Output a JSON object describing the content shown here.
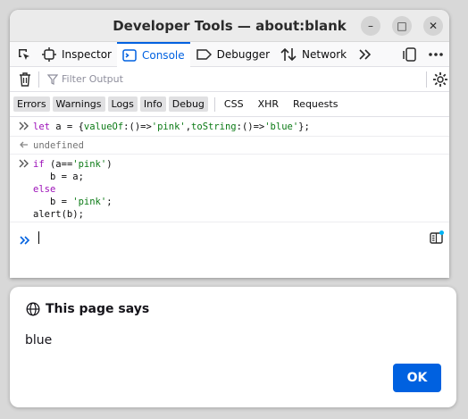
{
  "window": {
    "title": "Developer Tools — about:blank",
    "minimize_glyph": "–",
    "maximize_glyph": "□",
    "close_glyph": "✕"
  },
  "tabs": [
    {
      "label": "Inspector",
      "icon": "inspector-icon"
    },
    {
      "label": "Console",
      "icon": "console-icon",
      "active": true
    },
    {
      "label": "Debugger",
      "icon": "debugger-icon"
    },
    {
      "label": "Network",
      "icon": "network-icon"
    }
  ],
  "filter": {
    "placeholder": "Filter Output"
  },
  "categories": [
    "Errors",
    "Warnings",
    "Logs",
    "Info",
    "Debug"
  ],
  "categories_plain": [
    "CSS",
    "XHR",
    "Requests"
  ],
  "console": {
    "line1": {
      "t1": "let",
      "t2": " a = {",
      "t3": "valueOf",
      "t4": ":()=>",
      "t5": "'pink'",
      "t6": ",",
      "t7": "toString",
      "t8": ":()=>",
      "t9": "'blue'",
      "t10": "};"
    },
    "result1": "undefined",
    "block": {
      "l1a": "if",
      "l1b": " (a==",
      "l1c": "'pink'",
      "l1d": ")",
      "l2": "   b = a;",
      "l3": "else",
      "l4a": "   b = ",
      "l4b": "'pink'",
      "l4c": ";",
      "l5": "alert(b);"
    }
  },
  "dialog": {
    "title": "This page says",
    "message": "blue",
    "ok_label": "OK"
  },
  "colors": {
    "accent": "#0061e0"
  }
}
